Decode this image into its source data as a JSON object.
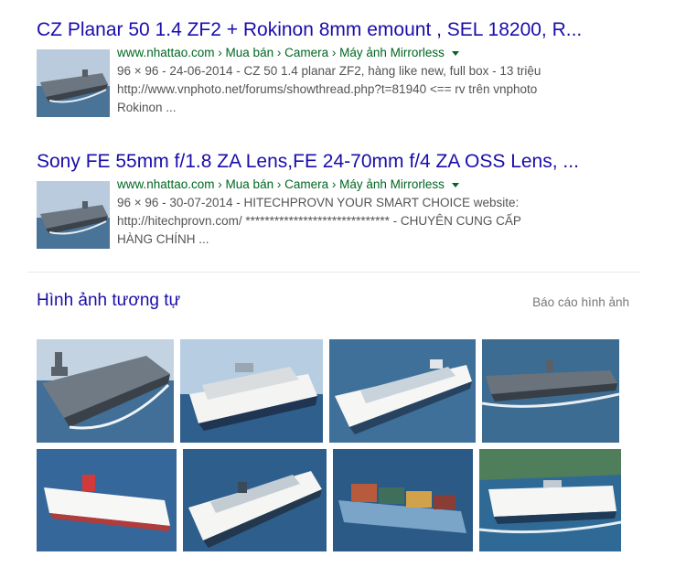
{
  "results": [
    {
      "title": "CZ Planar 50 1.4 ZF2 + Rokinon 8mm emount , SEL 18200, R...",
      "cite": "www.nhattao.com › Mua bán › Camera › Máy ảnh Mirrorless",
      "meta": "96 × 96 - 24-06-2014 - CZ 50 1.4 planar ZF2, hàng like new, full box - 13 triệu",
      "line2": "http://www.vnphoto.net/forums/showthread.php?t=81940 <== rv trên vnphoto",
      "line3": "Rokinon ..."
    },
    {
      "title": "Sony FE 55mm f/1.8 ZA Lens,FE 24-70mm f/4 ZA OSS Lens, ...",
      "cite": "www.nhattao.com › Mua bán › Camera › Máy ảnh Mirrorless",
      "meta": "96 × 96 - 30-07-2014 - HITECHPROVN YOUR SMART CHOICE website:",
      "line2": "http://hitechprovn.com/ ****************************** - CHUYÊN CUNG CẤP",
      "line3": "HÀNG CHÍNH ..."
    }
  ],
  "similar": {
    "title": "Hình ảnh tương tự",
    "report": "Báo cáo hình ảnh",
    "images": [
      {
        "subject": "aircraft-carrier"
      },
      {
        "subject": "cruise-ship"
      },
      {
        "subject": "cruise-ship"
      },
      {
        "subject": "aircraft-carrier"
      },
      {
        "subject": "cruise-ship"
      },
      {
        "subject": "cruise-ship"
      },
      {
        "subject": "container-ship"
      },
      {
        "subject": "cruise-ship"
      }
    ]
  },
  "colors": {
    "link": "#1a0dab",
    "cite": "#006621",
    "snippet": "#545454",
    "sea": "#3f6d94",
    "sky": "#b9cbdc"
  }
}
